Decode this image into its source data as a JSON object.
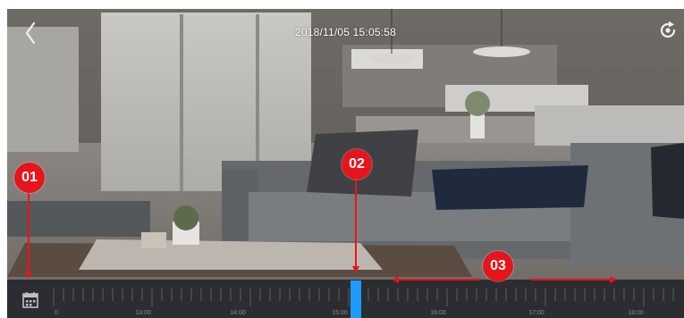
{
  "header": {
    "back_icon": "chevron-left-icon",
    "timestamp": "2018/11/05 15:05:58",
    "rotate_icon": "rotate-icon"
  },
  "timeline": {
    "calendar_icon": "calendar-icon",
    "labels": [
      "0",
      "13:00",
      "14:00",
      "15:00",
      "16:00",
      "17:00",
      "18:00"
    ],
    "playhead_color": "#1e9bff",
    "background_color": "#2b2d30"
  },
  "annotations": [
    {
      "label": "01"
    },
    {
      "label": "02"
    },
    {
      "label": "03"
    }
  ],
  "colors": {
    "callout": "#e8141c"
  }
}
